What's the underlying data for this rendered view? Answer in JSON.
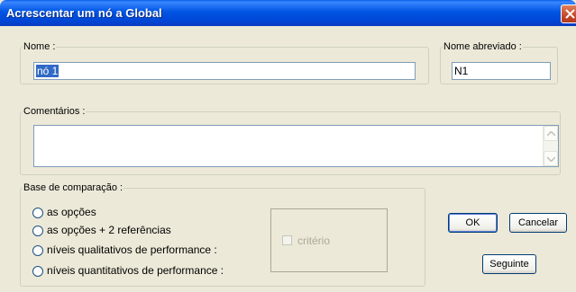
{
  "window": {
    "title": "Acrescentar um nó a Global"
  },
  "nome": {
    "legend": "Nome :",
    "value": "nó 1"
  },
  "nome_abreviado": {
    "legend": "Nome abreviado :",
    "value": "N1"
  },
  "comentarios": {
    "legend": "Comentários :",
    "value": ""
  },
  "base": {
    "legend": "Base de comparação :",
    "options": [
      "as opções",
      "as opções + 2 referências",
      "níveis qualitativos de performance :",
      "níveis quantitativos de performance :"
    ],
    "criterio_label": "critério"
  },
  "buttons": {
    "ok_label": "OK",
    "cancelar_label": "Cancelar",
    "seguinte_label": "Seguinte"
  },
  "colors": {
    "title_bar": "#0055e3",
    "selection": "#316ac5",
    "dialog_bg": "#ece9d8"
  }
}
